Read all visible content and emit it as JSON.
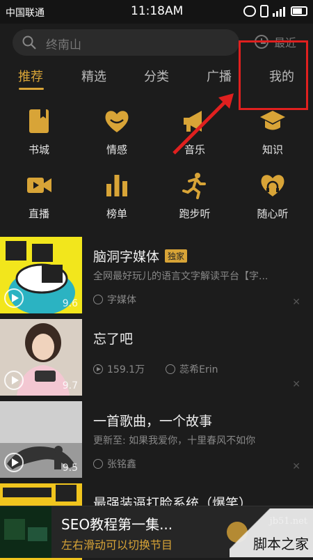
{
  "status_bar": {
    "carrier": "中国联通",
    "time": "11:18AM"
  },
  "search": {
    "placeholder": "终南山",
    "recent_label": "最近"
  },
  "tabs": [
    {
      "label": "推荐",
      "active": true
    },
    {
      "label": "精选"
    },
    {
      "label": "分类"
    },
    {
      "label": "广播"
    },
    {
      "label": "我的"
    }
  ],
  "categories": [
    {
      "label": "书城",
      "icon": "book-icon"
    },
    {
      "label": "情感",
      "icon": "heart-icon"
    },
    {
      "label": "音乐",
      "icon": "megaphone-icon"
    },
    {
      "label": "知识",
      "icon": "graduation-cap-icon"
    },
    {
      "label": "直播",
      "icon": "video-camera-icon"
    },
    {
      "label": "榜单",
      "icon": "bar-chart-icon"
    },
    {
      "label": "跑步听",
      "icon": "runner-icon"
    },
    {
      "label": "随心听",
      "icon": "heart-headphones-icon"
    }
  ],
  "list": [
    {
      "title": "脑洞字媒体",
      "badge": "独家",
      "description": "全网最好玩儿的语言文字解读平台【字...",
      "author": "字媒体",
      "score": "9.6"
    },
    {
      "title": "忘了吧",
      "plays": "159.1万",
      "author": "蕊希Erin",
      "score": "9.7"
    },
    {
      "title": "一首歌曲，一个故事",
      "description": "更新至: 如果我爱你，十里春风不如你",
      "author": "张铭鑫",
      "score": "9.5"
    },
    {
      "title": "最强装逼打脸系统（爆笑）"
    }
  ],
  "player": {
    "title": "SEO教程第一集...",
    "subtitle": "左右滑动可以切换节目"
  },
  "watermark": {
    "site": "jb51.net",
    "name": "脚本之家"
  },
  "colors": {
    "accent": "#d8a437",
    "background": "#1c1c1c",
    "annotation": "#e0201f"
  }
}
